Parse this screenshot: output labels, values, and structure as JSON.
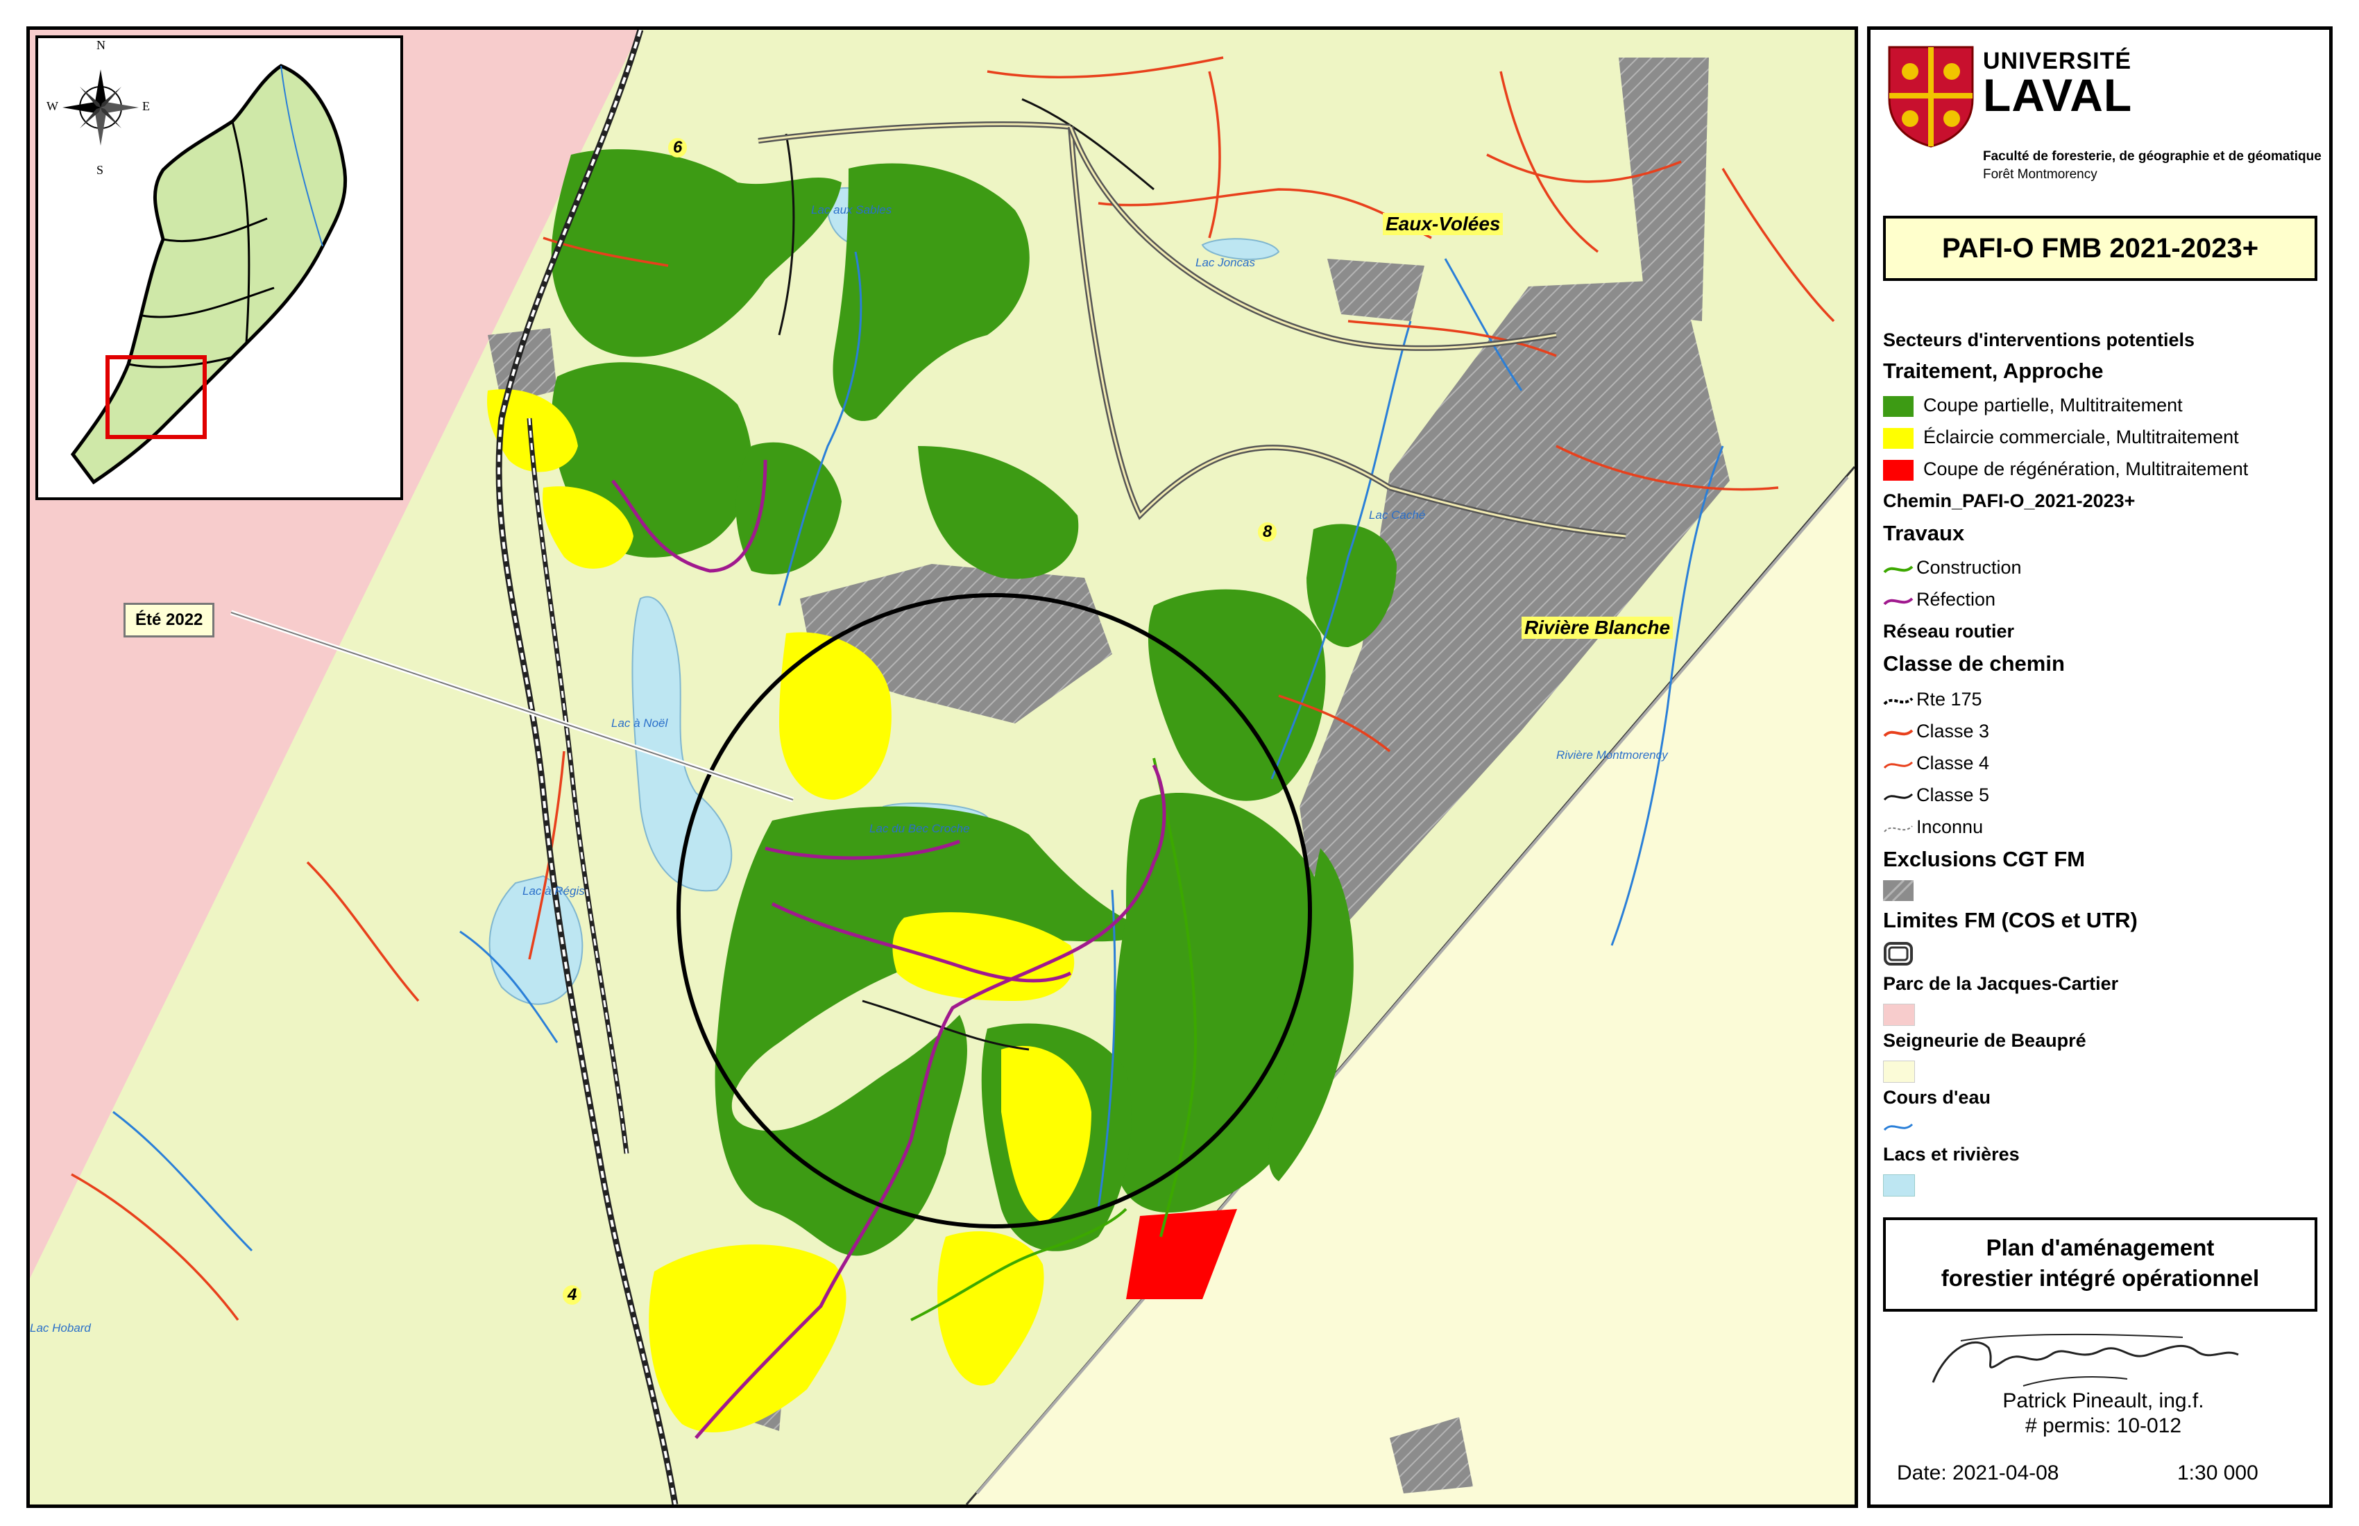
{
  "map": {
    "place_labels": {
      "lac_aux_sables": "Lac aux Sables",
      "lac_joncas": "Lac Joncas",
      "lac_cache": "Lac Caché",
      "lac_a_noel": "Lac à Noël",
      "lac_du_bec_croche": "Lac du Bec Croche",
      "lac_a_regis": "Lac à Régis",
      "riviere_montmorency": "Rivière Montmorency",
      "lac_hobard": "Lac Hobard"
    },
    "highlight_labels": {
      "eaux_volees": "Eaux-Volées",
      "riviere_blanche": "Rivière Blanche"
    },
    "road_numbers": {
      "r6": "6",
      "r8": "8",
      "r4": "4"
    },
    "callout": "Été 2022",
    "inset": {
      "compass": {
        "n": "N",
        "s": "S",
        "e": "E",
        "w": "W"
      }
    },
    "colors": {
      "background": "#eef5c4",
      "parc": "#f7cccc",
      "seigneurie": "#fbfbd7",
      "partial_cut": "#3d9b14",
      "commercial_thinning": "#ffff00",
      "regeneration_cut": "#ff0000",
      "exclusion": "#8c8c8c",
      "water": "#bde6f2",
      "stream": "#2a7fd8",
      "road_class3": "#e8401c",
      "road_class4": "#e8401c",
      "road_class5": "#111111",
      "construction": "#3ca800",
      "refection": "#a0198e"
    }
  },
  "legend": {
    "university": {
      "name1": "UNIVERSITÉ",
      "name2": "LAVAL",
      "faculty": "Faculté de foresterie, de géographie et de géomatique",
      "unit": "Forêt Montmorency"
    },
    "title": "PAFI-O FMB 2021-2023+",
    "sectors_title": "Secteurs d'interventions potentiels",
    "treatment_title": "Traitement, Approche",
    "treatments": [
      "Coupe partielle, Multitraitement",
      "Éclaircie commerciale, Multitraitement",
      "Coupe de régénération, Multitraitement"
    ],
    "chemin_title": "Chemin_PAFI-O_2021-2023+",
    "travaux_title": "Travaux",
    "travaux": [
      "Construction",
      "Réfection"
    ],
    "reseau_title": "Réseau routier",
    "classe_title": "Classe de chemin",
    "classes": [
      "Rte 175",
      "Classe 3",
      "Classe 4",
      "Classe 5",
      "Inconnu"
    ],
    "exclusions": "Exclusions CGT FM",
    "limites": "Limites FM (COS et UTR)",
    "parc": "Parc de la Jacques-Cartier",
    "seigneurie": "Seigneurie de Beaupré",
    "cours_eau": "Cours d'eau",
    "lacs": "Lacs et rivières",
    "plan": {
      "line1": "Plan d'aménagement",
      "line2": "forestier intégré opérationnel"
    },
    "signature": {
      "name": "Patrick Pineault, ing.f.",
      "permit": "# permis: 10-012"
    },
    "date": "Date: 2021-04-08",
    "scale": "1:30 000"
  }
}
